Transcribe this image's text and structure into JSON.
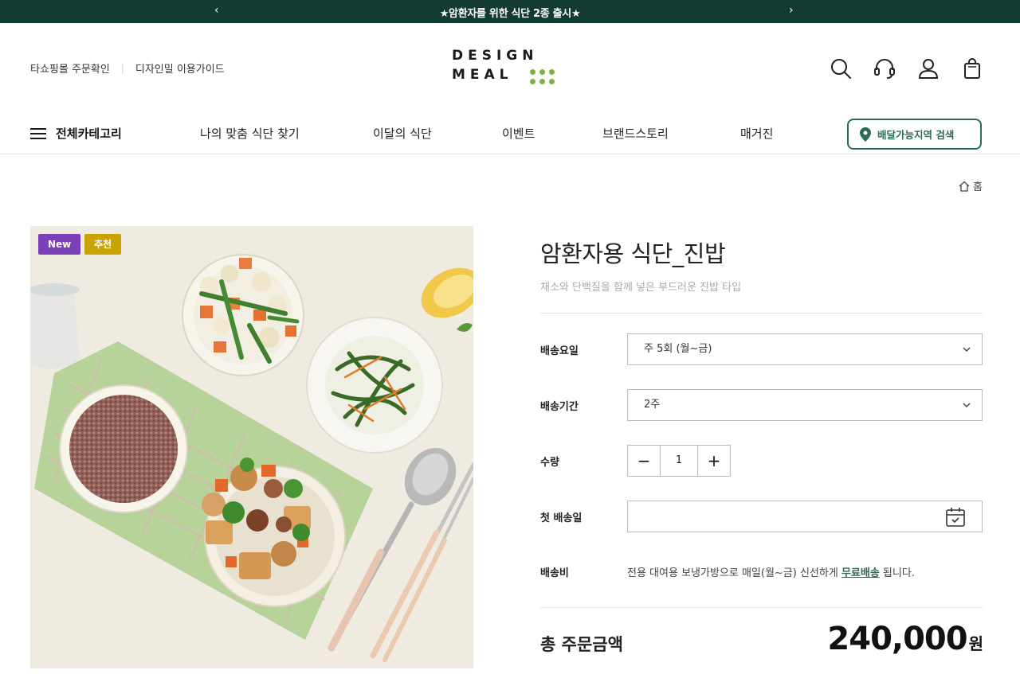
{
  "topbar": {
    "notice": "★암환자를 위한 식단 2종 출시★",
    "prev_icon": "chevron-left-icon",
    "next_icon": "chevron-right-icon",
    "prev_glyph": "‹",
    "next_glyph": "›",
    "background": "#133a33"
  },
  "util_links": {
    "order_check": "타쇼핑몰 주문확인",
    "separator": "|",
    "guide": "디자인밀 이용가이드"
  },
  "logo": {
    "line1": "DESIGN",
    "line2": "MEAL",
    "dot_color": "#7cb342"
  },
  "header_icons": [
    "search-icon",
    "headset-icon",
    "user-icon",
    "shopping-bag-icon"
  ],
  "gnb": {
    "all_category": "전체카테고리",
    "menus": [
      "나의 맞춤 식단 찾기",
      "이달의 식단",
      "이벤트",
      "브랜드스토리",
      "매거진"
    ],
    "delivery_search": "배달가능지역 검색",
    "accent": "#2d6a57"
  },
  "breadcrumb": {
    "home": "홈"
  },
  "product": {
    "badges": {
      "new": "New",
      "recommended": "추천"
    },
    "title": "암환자용 식단_진밥",
    "subtitle": "채소와 단백질을 함께 넣은 부드러운 진밥 타입",
    "options": {
      "delivery_day_label": "배송요일",
      "delivery_day_value": "주 5회 (월~금)",
      "delivery_period_label": "배송기간",
      "delivery_period_value": "2주",
      "quantity_label": "수량",
      "quantity_value": "1",
      "minus": "−",
      "plus": "+",
      "first_delivery_label": "첫 배송일",
      "shipping_fee_label": "배송비",
      "shipping_text_before": "전용 대여용 보냉가방으로 매일(월~금) 신선하게 ",
      "shipping_link": "무료배송",
      "shipping_text_after": " 됩니다."
    },
    "total": {
      "label": "총 주문금액",
      "price": "240,000",
      "unit": "원"
    }
  }
}
